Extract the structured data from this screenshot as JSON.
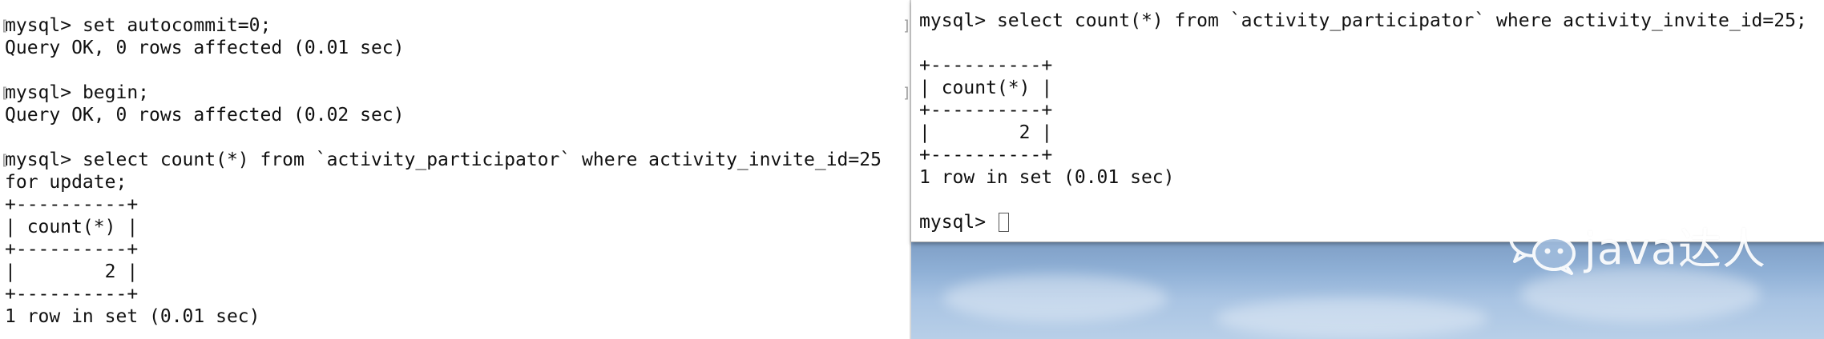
{
  "left_terminal": {
    "lines": [
      {
        "prompt": "mysql> ",
        "text": "set autocommit=0;"
      },
      {
        "prompt": "",
        "text": "Query OK, 0 rows affected (0.01 sec)"
      },
      {
        "prompt": "",
        "text": ""
      },
      {
        "prompt": "mysql> ",
        "text": "begin;"
      },
      {
        "prompt": "",
        "text": "Query OK, 0 rows affected (0.02 sec)"
      },
      {
        "prompt": "",
        "text": ""
      },
      {
        "prompt": "mysql> ",
        "text": "select count(*) from `activity_participator` where activity_invite_id=25"
      },
      {
        "prompt": "",
        "text": "for update;"
      },
      {
        "prompt": "",
        "text": "+----------+"
      },
      {
        "prompt": "",
        "text": "| count(*) |"
      },
      {
        "prompt": "",
        "text": "+----------+"
      },
      {
        "prompt": "",
        "text": "|        2 |"
      },
      {
        "prompt": "",
        "text": "+----------+"
      },
      {
        "prompt": "",
        "text": "1 row in set (0.01 sec)"
      }
    ]
  },
  "right_terminal": {
    "lines": [
      {
        "prompt": "mysql> ",
        "text": "select count(*) from `activity_participator` where activity_invite_id=25;"
      },
      {
        "prompt": "",
        "text": ""
      },
      {
        "prompt": "",
        "text": "+----------+"
      },
      {
        "prompt": "",
        "text": "| count(*) |"
      },
      {
        "prompt": "",
        "text": "+----------+"
      },
      {
        "prompt": "",
        "text": "|        2 |"
      },
      {
        "prompt": "",
        "text": "+----------+"
      },
      {
        "prompt": "",
        "text": "1 row in set (0.01 sec)"
      },
      {
        "prompt": "",
        "text": ""
      }
    ],
    "active_prompt": "mysql> "
  },
  "watermark": {
    "text": "java达人",
    "icon": "wechat-icon"
  },
  "colors": {
    "terminal_background": "#ffffff",
    "terminal_text": "#111111",
    "desktop_sky": "#8fb0d6"
  }
}
